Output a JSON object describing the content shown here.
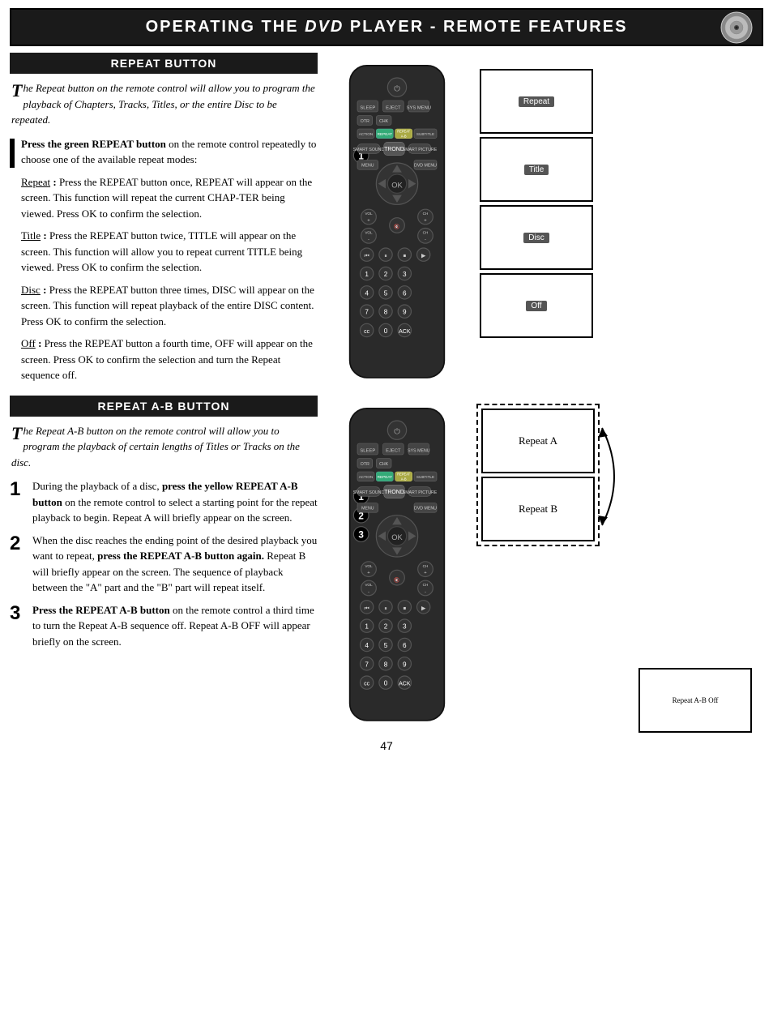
{
  "header": {
    "title": "Operating the DVD Player - Remote Features",
    "title_parts": {
      "operating": "Operating the",
      "dvd": "DVD",
      "player": "Player",
      "dash": "-",
      "remote": "Remote",
      "features": "Features"
    }
  },
  "repeat_button_section": {
    "heading": "Repeat Button",
    "intro": "he Repeat button on the remote control will allow you to program the playback of Chapters, Tracks, Titles, or the entire Disc to be repeated.",
    "drop_cap": "T",
    "step1": {
      "bar": true,
      "text_bold": "Press the green REPEAT button",
      "text_rest": " on the remote control repeatedly to choose one of the available repeat modes:"
    },
    "sub_items": [
      {
        "label": "Repeat :",
        "text": "Press the REPEAT button once, REPEAT will appear on the screen. This function will repeat the current CHAP-TER being viewed. Press OK to confirm the selection."
      },
      {
        "label": "Title :",
        "text": "Press the REPEAT button twice, TITLE will appear on the screen. This function will allow you to repeat current TITLE being viewed. Press OK to confirm the selection."
      },
      {
        "label": "Disc :",
        "text": "Press the REPEAT button three times, DISC will appear on the screen. This function will repeat playback of the entire DISC content. Press OK to confirm the selection."
      },
      {
        "label": "Off :",
        "text": "Press the REPEAT button a fourth time, OFF will appear on the screen. Press OK to confirm the selection and turn the Repeat sequence off."
      }
    ]
  },
  "repeat_ab_section": {
    "heading": "Repeat A-B Button",
    "intro": "he Repeat A-B button on the remote control will allow you to program the playback of certain lengths of Titles or Tracks on the disc.",
    "drop_cap": "T",
    "steps": [
      {
        "number": "1",
        "text_bold": "During the playback of a disc, press the yellow REPEAT A-B button",
        "text_rest": " on the remote control to select a starting point for the repeat playback to begin. Repeat A will briefly appear on the screen."
      },
      {
        "number": "2",
        "text_start": "When the disc reaches the ending point of the desired playback you want to repeat, ",
        "text_bold": "press the REPEAT A-B button again.",
        "text_rest": " Repeat B will briefly appear on the screen. The sequence of playback between the \"A\" part  and the \"B\" part will repeat itself."
      },
      {
        "number": "3",
        "text_bold": "Press the REPEAT A-B button",
        "text_rest": " on the remote control a third time to turn the Repeat A-B sequence off. Repeat A-B OFF will appear briefly on the screen."
      }
    ]
  },
  "screens": {
    "repeat": [
      "Repeat",
      "Title",
      "Disc",
      "Off"
    ],
    "ab": [
      "Repeat A",
      "Repeat B",
      "Repeat A-B Off"
    ]
  },
  "page_number": "47"
}
